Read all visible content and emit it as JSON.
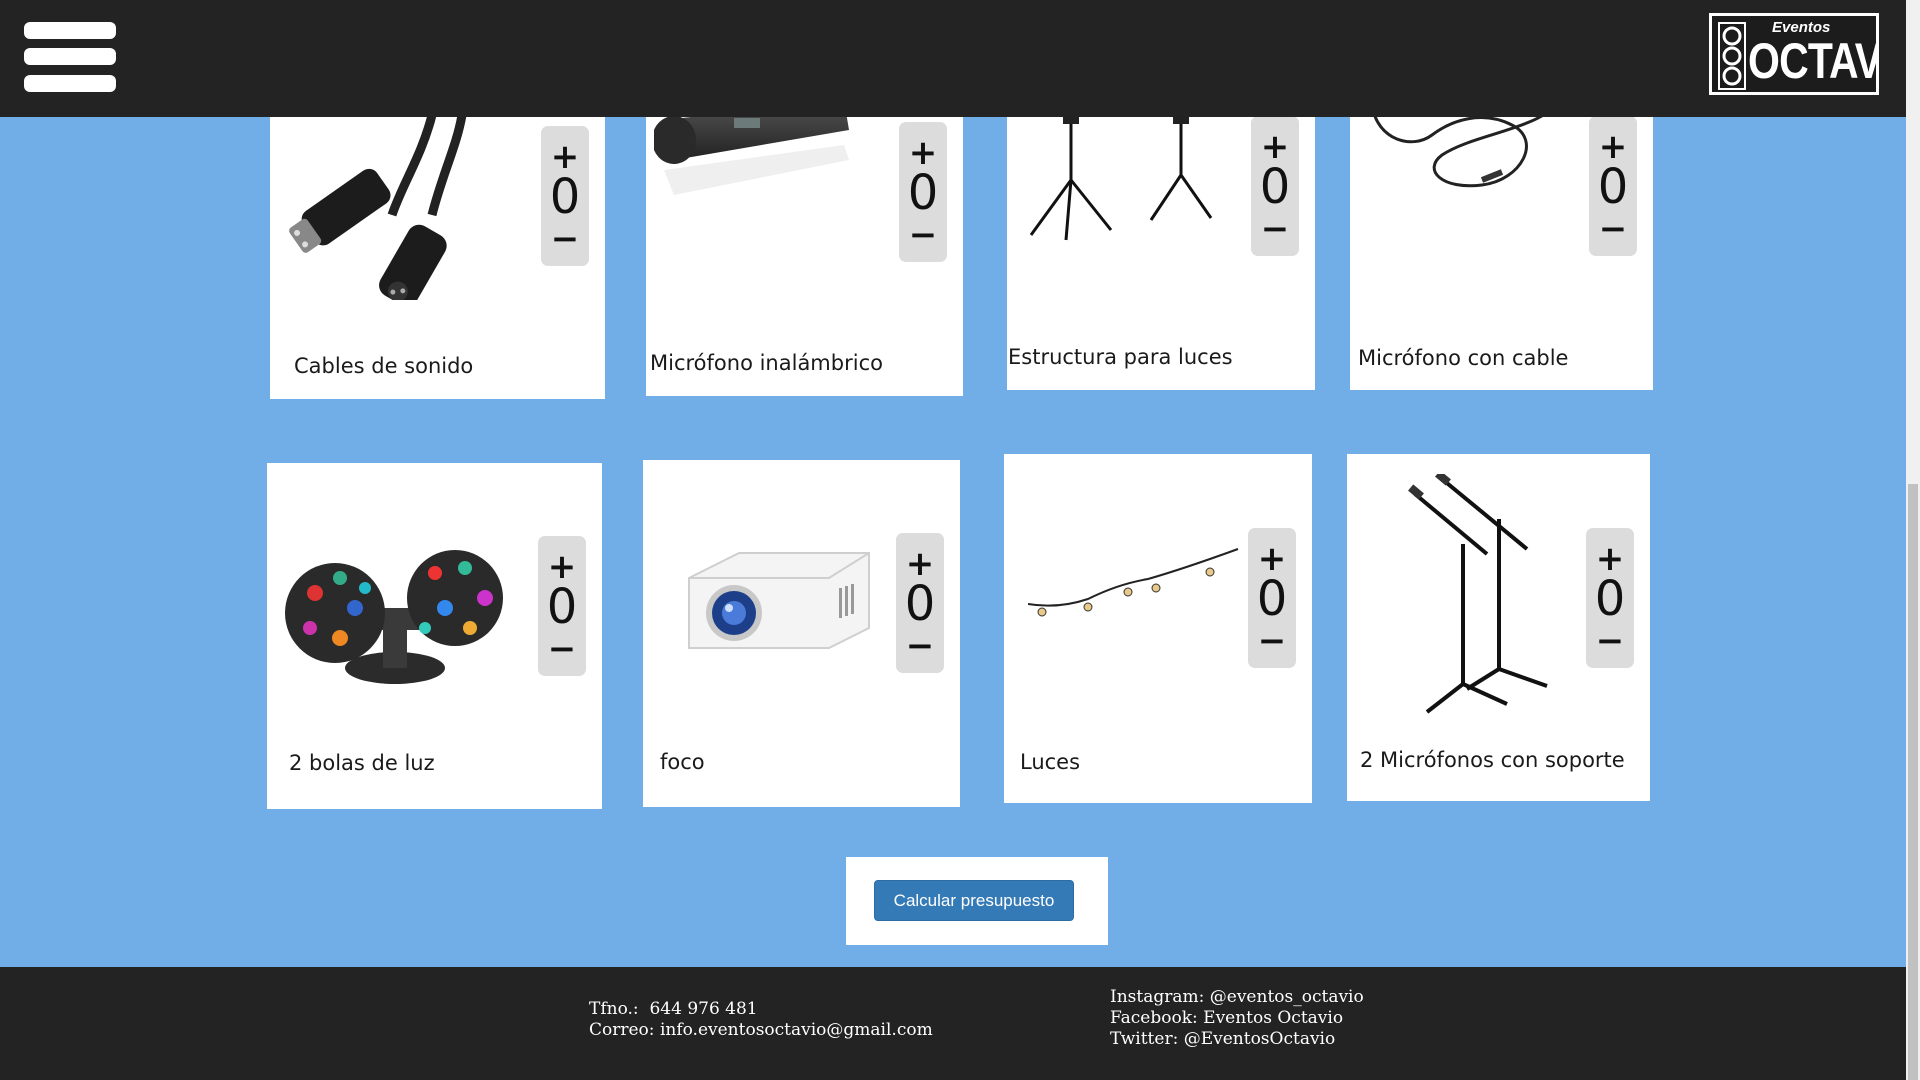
{
  "header": {
    "menu_icon": "hamburger-menu-icon",
    "logo": {
      "top_text": "Eventos",
      "main_text": "OCTAVIO"
    }
  },
  "products": [
    {
      "name": "Cables de sonido",
      "quantity": "0",
      "image": "xlr-cable-image"
    },
    {
      "name": "Micrófono inalámbrico",
      "quantity": "0",
      "image": "wireless-microphone-image"
    },
    {
      "name": "Estructura para luces",
      "quantity": "0",
      "image": "light-stand-image"
    },
    {
      "name": "Micrófono con cable",
      "quantity": "0",
      "image": "wired-microphone-image"
    },
    {
      "name": "2 bolas de luz",
      "quantity": "0",
      "image": "disco-ball-lights-image"
    },
    {
      "name": "foco",
      "quantity": "0",
      "image": "projector-image"
    },
    {
      "name": "Luces",
      "quantity": "0",
      "image": "string-lights-image"
    },
    {
      "name": "2 Micrófonos con soporte",
      "quantity": "0",
      "image": "microphone-stands-image"
    }
  ],
  "stepper": {
    "plus": "+",
    "minus": "−"
  },
  "budget": {
    "button_label": "Calcular presupuesto"
  },
  "footer": {
    "phone_label": "Tfno.:",
    "phone": "644 976 481",
    "email_label": "Correo:",
    "email": "info.eventosoctavio@gmail.com",
    "instagram_label": "Instagram:",
    "instagram": "@eventos_octavio",
    "facebook_label": "Facebook:",
    "facebook": "Eventos Octavio",
    "twitter_label": "Twitter:",
    "twitter": "@EventosOctavio"
  },
  "colors": {
    "page_background": "#71ade6",
    "header_background": "#232323",
    "footer_background": "#232323",
    "button_primary": "#337ab7",
    "card_background": "#ffffff",
    "stepper_background": "#dcdcdc"
  }
}
